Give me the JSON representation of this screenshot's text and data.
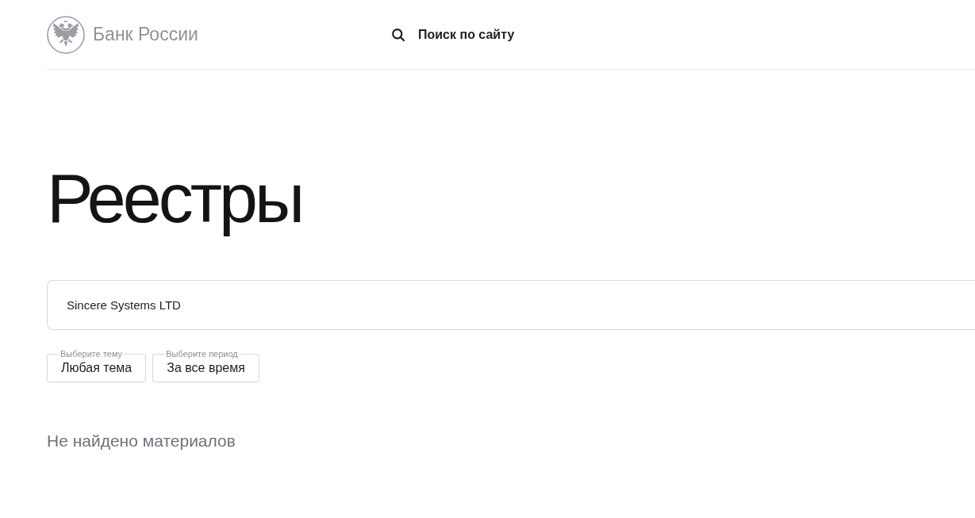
{
  "header": {
    "logo_text": "Банк России",
    "search_link": "Поиск по сайту"
  },
  "page": {
    "title": "Реестры"
  },
  "search": {
    "value": "Sincere Systems LTD"
  },
  "filters": [
    {
      "label": "Выберите тему",
      "value": "Любая тема"
    },
    {
      "label": "Выберите период",
      "value": "За все время"
    }
  ],
  "results": {
    "message": "Не найдено материалов"
  }
}
